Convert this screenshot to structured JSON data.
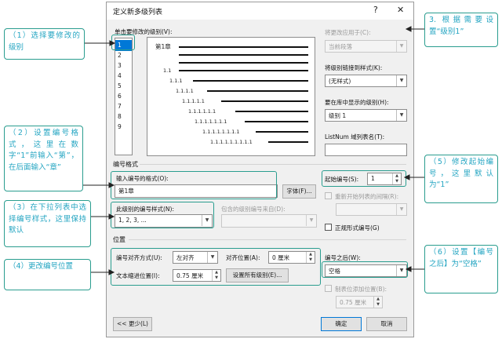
{
  "dialog": {
    "title": "定义新多级列表",
    "help": "?",
    "close": "✕",
    "levels_label": "单击要修改的级别(V):",
    "levels": [
      "1",
      "2",
      "3",
      "4",
      "5",
      "6",
      "7",
      "8",
      "9"
    ],
    "selected_level": "1",
    "preview": {
      "chapter": "第1章",
      "rows": [
        "1.1",
        "1.1.1",
        "1.1.1.1",
        "1.1.1.1.1",
        "1.1.1.1.1.1",
        "1.1.1.1.1.1.1",
        "1.1.1.1.1.1.1.1",
        "1.1.1.1.1.1.1.1.1"
      ]
    },
    "apply_to": {
      "label": "将更改应用于(C):",
      "value": "当前段落"
    },
    "link_style": {
      "label": "将级别链接到样式(K):",
      "value": "(无样式)"
    },
    "gallery_level": {
      "label": "要在库中显示的级别(H):",
      "value": "级别 1"
    },
    "listnum": {
      "label": "ListNum 域列表名(T):",
      "value": ""
    },
    "number_format": {
      "section": "编号格式",
      "format_label": "输入编号的格式(O):",
      "format_value": "第1章",
      "font_button": "字体(F)...",
      "style_label": "此级别的编号样式(N):",
      "style_value": "1, 2, 3, ...",
      "include_label": "包含的级别编号来自(D):",
      "include_value": "",
      "start_label": "起始编号(S):",
      "start_value": "1",
      "restart_label": "重新开始列表的间隔(R):",
      "restart_value": "",
      "legal_label": "正规形式编号(G)"
    },
    "position": {
      "section": "位置",
      "align_label": "编号对齐方式(U):",
      "align_value": "左对齐",
      "align_at_label": "对齐位置(A):",
      "align_at_value": "0 厘米",
      "indent_label": "文本缩进位置(I):",
      "indent_value": "0.75 厘米",
      "set_all_button": "设置所有级别(E)...",
      "follow_label": "编号之后(W):",
      "follow_value": "空格",
      "tab_label": "制表位添加位置(B):",
      "tab_value": "0.75 厘米"
    },
    "less_button": "<< 更少(L)",
    "ok_button": "确定",
    "cancel_button": "取消"
  },
  "callouts": {
    "c1": "（1）选择要修改的级别",
    "c2": "（2）设置编号格式，这里在数字“1”前输入“第”，在后面输入“章”",
    "c3": "（3）在下拉列表中选择编号样式，这里保持默认",
    "c4": "（4）更改编号位置",
    "c5": "3. 根据需要设置“级别1”",
    "c6": "（5）修改起始编号，这里默认为“1”",
    "c7": "（6）设置【编号之后】为“空格”"
  },
  "colors": {
    "callout_text": "#24a5c2",
    "callout_border": "#2a9d8f",
    "selection": "#0078d7"
  }
}
